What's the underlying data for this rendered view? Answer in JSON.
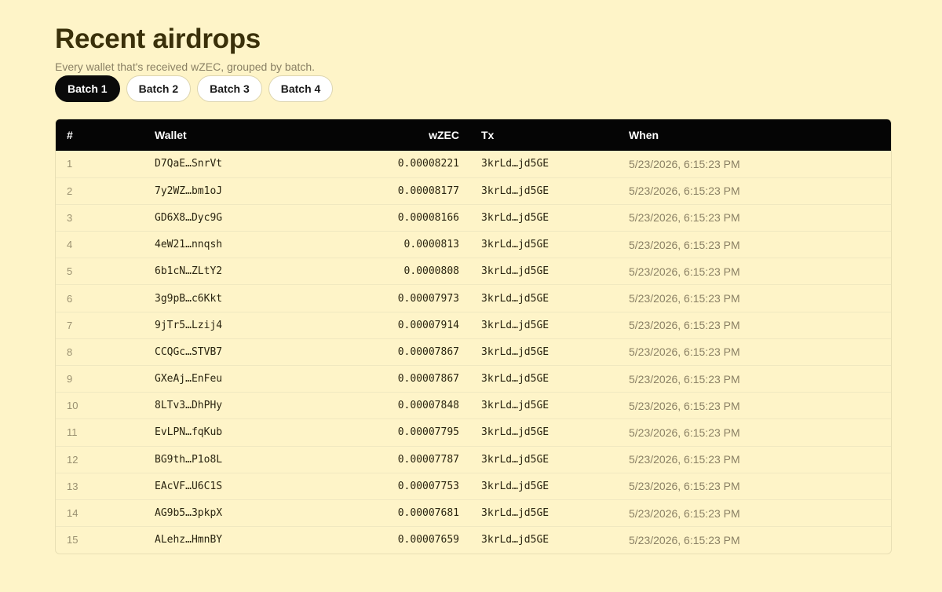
{
  "header": {
    "title": "Recent airdrops",
    "subtitle": "Every wallet that's received wZEC, grouped by batch."
  },
  "tabs": [
    {
      "label": "Batch 1",
      "active": true
    },
    {
      "label": "Batch 2",
      "active": false
    },
    {
      "label": "Batch 3",
      "active": false
    },
    {
      "label": "Batch 4",
      "active": false
    }
  ],
  "table": {
    "columns": [
      "#",
      "Wallet",
      "wZEC",
      "Tx",
      "When"
    ],
    "rows": [
      {
        "idx": "1",
        "wallet": "D7QaE…SnrVt",
        "amount": "0.00008221",
        "tx": "3krLd…jd5GE",
        "when": "5/23/2026, 6:15:23 PM"
      },
      {
        "idx": "2",
        "wallet": "7y2WZ…bm1oJ",
        "amount": "0.00008177",
        "tx": "3krLd…jd5GE",
        "when": "5/23/2026, 6:15:23 PM"
      },
      {
        "idx": "3",
        "wallet": "GD6X8…Dyc9G",
        "amount": "0.00008166",
        "tx": "3krLd…jd5GE",
        "when": "5/23/2026, 6:15:23 PM"
      },
      {
        "idx": "4",
        "wallet": "4eW21…nnqsh",
        "amount": "0.0000813",
        "tx": "3krLd…jd5GE",
        "when": "5/23/2026, 6:15:23 PM"
      },
      {
        "idx": "5",
        "wallet": "6b1cN…ZLtY2",
        "amount": "0.0000808",
        "tx": "3krLd…jd5GE",
        "when": "5/23/2026, 6:15:23 PM"
      },
      {
        "idx": "6",
        "wallet": "3g9pB…c6Kkt",
        "amount": "0.00007973",
        "tx": "3krLd…jd5GE",
        "when": "5/23/2026, 6:15:23 PM"
      },
      {
        "idx": "7",
        "wallet": "9jTr5…Lzij4",
        "amount": "0.00007914",
        "tx": "3krLd…jd5GE",
        "when": "5/23/2026, 6:15:23 PM"
      },
      {
        "idx": "8",
        "wallet": "CCQGc…STVB7",
        "amount": "0.00007867",
        "tx": "3krLd…jd5GE",
        "when": "5/23/2026, 6:15:23 PM"
      },
      {
        "idx": "9",
        "wallet": "GXeAj…EnFeu",
        "amount": "0.00007867",
        "tx": "3krLd…jd5GE",
        "when": "5/23/2026, 6:15:23 PM"
      },
      {
        "idx": "10",
        "wallet": "8LTv3…DhPHy",
        "amount": "0.00007848",
        "tx": "3krLd…jd5GE",
        "when": "5/23/2026, 6:15:23 PM"
      },
      {
        "idx": "11",
        "wallet": "EvLPN…fqKub",
        "amount": "0.00007795",
        "tx": "3krLd…jd5GE",
        "when": "5/23/2026, 6:15:23 PM"
      },
      {
        "idx": "12",
        "wallet": "BG9th…P1o8L",
        "amount": "0.00007787",
        "tx": "3krLd…jd5GE",
        "when": "5/23/2026, 6:15:23 PM"
      },
      {
        "idx": "13",
        "wallet": "EAcVF…U6C1S",
        "amount": "0.00007753",
        "tx": "3krLd…jd5GE",
        "when": "5/23/2026, 6:15:23 PM"
      },
      {
        "idx": "14",
        "wallet": "AG9b5…3pkpX",
        "amount": "0.00007681",
        "tx": "3krLd…jd5GE",
        "when": "5/23/2026, 6:15:23 PM"
      },
      {
        "idx": "15",
        "wallet": "ALehz…HmnBY",
        "amount": "0.00007659",
        "tx": "3krLd…jd5GE",
        "when": "5/23/2026, 6:15:23 PM"
      }
    ]
  }
}
